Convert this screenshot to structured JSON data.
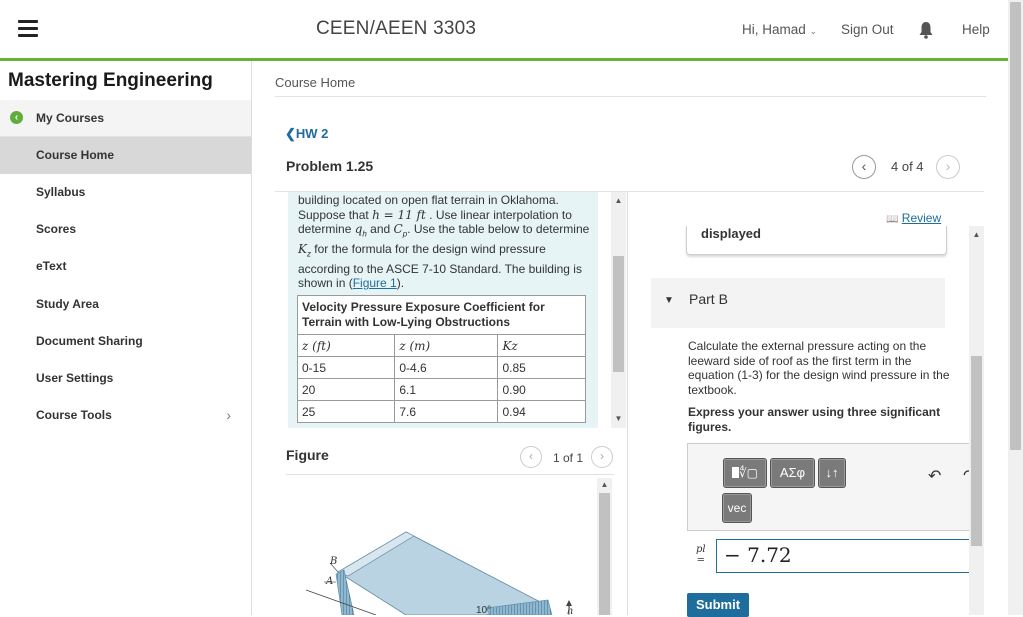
{
  "header": {
    "app_title": "CEEN/AEEN 3303",
    "greeting": "Hi, Hamad",
    "sign_out": "Sign Out",
    "help": "Help"
  },
  "sidebar": {
    "brand": "Mastering Engineering",
    "items": [
      {
        "label": "My Courses"
      },
      {
        "label": "Course Home"
      },
      {
        "label": "Syllabus"
      },
      {
        "label": "Scores"
      },
      {
        "label": "eText"
      },
      {
        "label": "Study Area"
      },
      {
        "label": "Document Sharing"
      },
      {
        "label": "User Settings"
      },
      {
        "label": "Course Tools"
      }
    ]
  },
  "main": {
    "breadcrumb": "Course Home",
    "hw_link": "HW 2",
    "problem_title": "Problem 1.25",
    "pager_text": "4 of 4"
  },
  "problem": {
    "line1": "building located on open flat terrain in Oklahoma.",
    "line2a": "Suppose that ",
    "h_expr": "h = 11  ft",
    "line2b": " . Use linear interpolation to",
    "line3a": "determine ",
    "qh": "q",
    "qh_sub": "h",
    "line3b": " and ",
    "cp": "C",
    "cp_sub": "p",
    "line3c": ". Use the table below to determine",
    "kz": "K",
    "kz_sub": "z",
    "line4": " for the formula for the design wind pressure",
    "line5": "according to the ASCE 7-10 Standard. The building is",
    "line6a": "shown in (",
    "figure_link": "Figure 1",
    "line6b": ")."
  },
  "table": {
    "caption": "Velocity Pressure Exposure Coefficient for Terrain with Low-Lying Obstructions",
    "headers": [
      "z (ft)",
      "z (m)",
      "Kz"
    ],
    "rows": [
      [
        "0-15",
        "0-4.6",
        "0.85"
      ],
      [
        "20",
        "6.1",
        "0.90"
      ],
      [
        "25",
        "7.6",
        "0.94"
      ]
    ]
  },
  "figure": {
    "title": "Figure",
    "pager_text": "1 of 1",
    "label_b": "B",
    "label_a": "A",
    "angle": "10°",
    "label_h": "h"
  },
  "right": {
    "review": "Review",
    "displayed": "displayed",
    "part_label": "Part B",
    "question": "Calculate the external pressure acting on the leeward side of roof as the first term in the equation (1-3) for the design wind pressure in the textbook.",
    "instruction": "Express your answer using three significant figures."
  },
  "editor": {
    "tool_greek": "ΑΣφ",
    "tool_updown": "↓↑",
    "tool_vec": "vec",
    "var_label_top": "pl",
    "var_label_eq": "=",
    "answer_value": "− 7.72",
    "submit": "Submit"
  },
  "colors": {
    "accent_green": "#63b23a",
    "link_blue": "#1f6d9c",
    "panel_bg": "#e6f4f6"
  }
}
